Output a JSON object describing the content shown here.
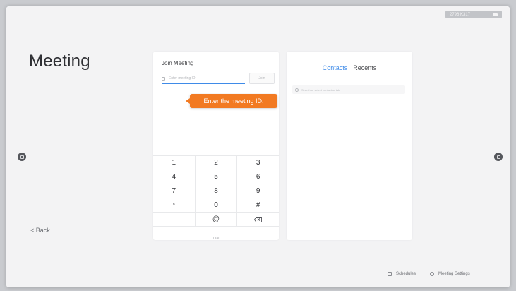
{
  "status": {
    "label": "2796 K317"
  },
  "page": {
    "title": "Meeting",
    "back": "< Back"
  },
  "join": {
    "heading": "Join Meeting",
    "placeholder": "Enter meeting ID",
    "join_label": "Join",
    "tooltip": "Enter the meeting ID.",
    "keypad": [
      [
        "1",
        "2",
        "3"
      ],
      [
        "4",
        "5",
        "6"
      ],
      [
        "7",
        "8",
        "9"
      ],
      [
        "*",
        "0",
        "#"
      ],
      [
        ".",
        "@",
        "backspace"
      ]
    ],
    "dial_label": "Dial"
  },
  "contacts": {
    "tabs": [
      "Contacts",
      "Recents"
    ],
    "active_tab": "Contacts",
    "search_placeholder": "Search or select contact or tab"
  },
  "bottom": {
    "schedules": "Schedules",
    "meeting_settings": "Meeting Settings"
  },
  "colors": {
    "accent": "#3f8be8",
    "tooltip": "#f27a22"
  },
  "icons": [
    "camera-icon",
    "search-icon",
    "backspace-icon",
    "calendar-icon",
    "gear-icon",
    "nav-icon"
  ]
}
